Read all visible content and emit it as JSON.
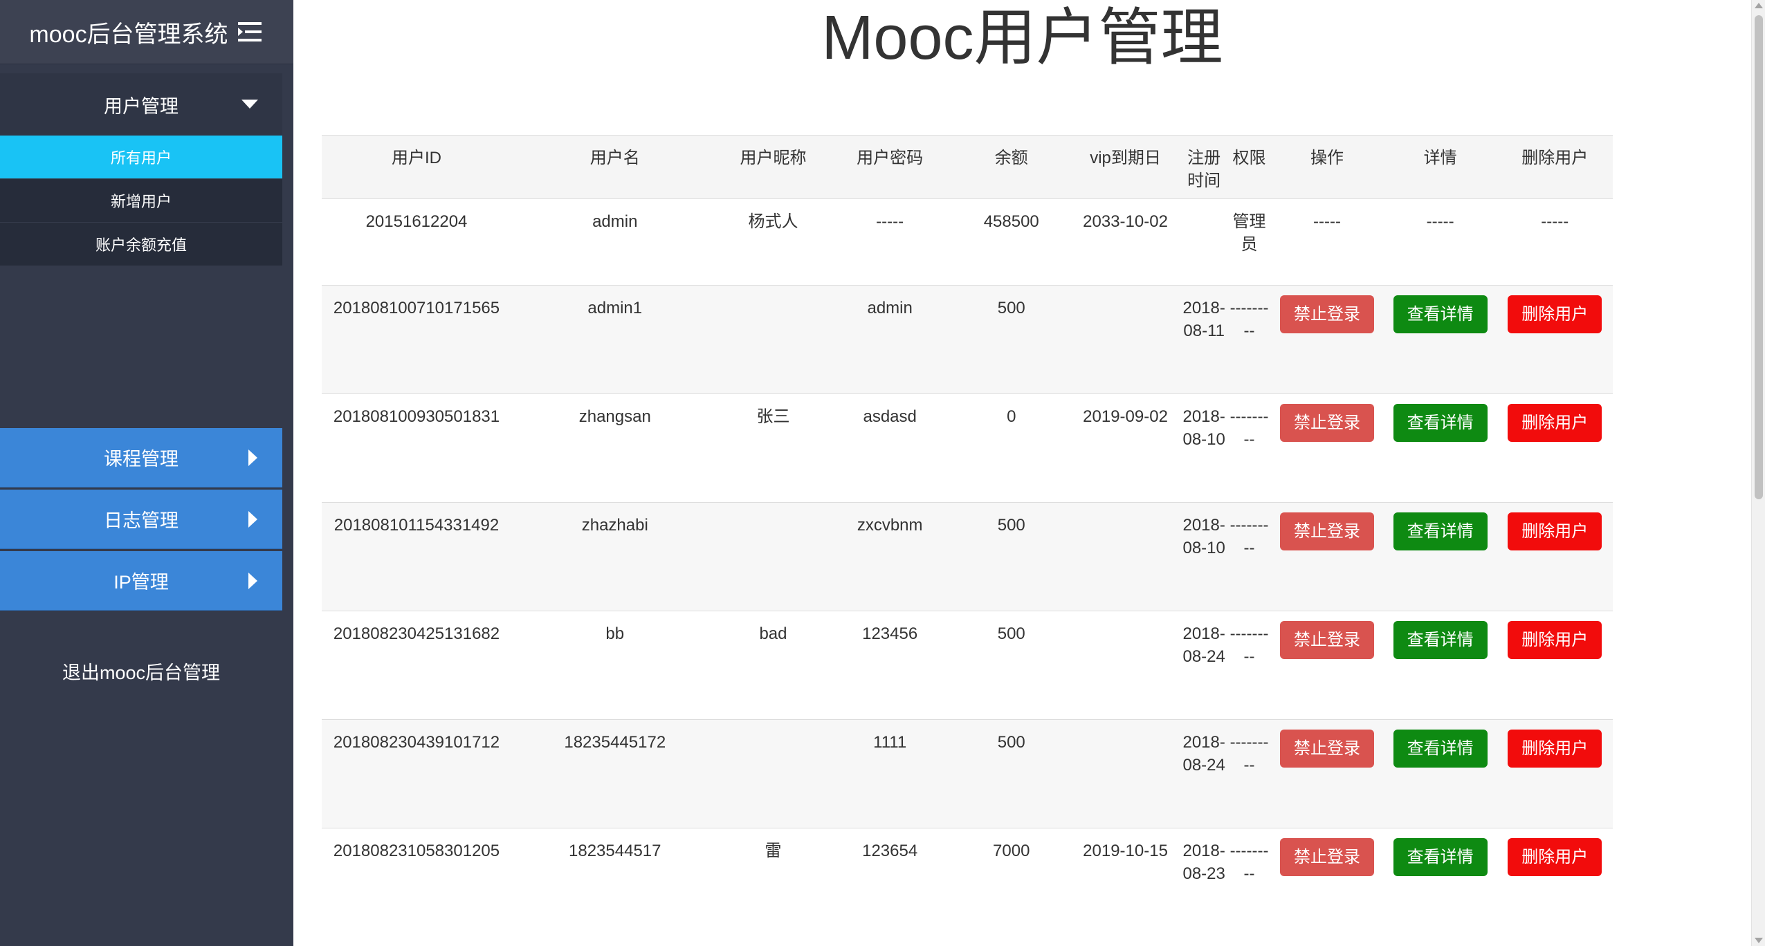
{
  "sidebar": {
    "brand": "mooc后台管理系统",
    "menu_user": "用户管理",
    "sub_items": [
      "所有用户",
      "新增用户",
      "账户余额充值"
    ],
    "menu_course": "课程管理",
    "menu_log": "日志管理",
    "menu_ip": "IP管理",
    "logout": "退出mooc后台管理"
  },
  "main": {
    "title": "Mooc用户管理"
  },
  "table": {
    "headers": {
      "id": "用户ID",
      "name": "用户名",
      "nickname": "用户昵称",
      "password": "用户密码",
      "balance": "余额",
      "vip": "vip到期日",
      "reg": "注册时间",
      "role": "权限",
      "op": "操作",
      "detail": "详情",
      "delete": "删除用户"
    },
    "admin_row": {
      "id": "20151612204",
      "name": "admin",
      "nickname": "杨式人",
      "password": "-----",
      "balance": "458500",
      "vip": "2033-10-02",
      "reg": "",
      "role": "管理员",
      "op": "-----",
      "detail": "-----",
      "delete": "-----"
    },
    "rows": [
      {
        "id": "201808100710171565",
        "name": "admin1",
        "nickname": "",
        "password": "admin",
        "balance": "500",
        "vip": "",
        "reg": "2018-08-11",
        "role": "---------"
      },
      {
        "id": "201808100930501831",
        "name": "zhangsan",
        "nickname": "张三",
        "password": "asdasd",
        "balance": "0",
        "vip": "2019-09-02",
        "reg": "2018-08-10",
        "role": "---------"
      },
      {
        "id": "201808101154331492",
        "name": "zhazhabi",
        "nickname": "",
        "password": "zxcvbnm",
        "balance": "500",
        "vip": "",
        "reg": "2018-08-10",
        "role": "---------"
      },
      {
        "id": "201808230425131682",
        "name": "bb",
        "nickname": "bad",
        "password": "123456",
        "balance": "500",
        "vip": "",
        "reg": "2018-08-24",
        "role": "---------"
      },
      {
        "id": "201808230439101712",
        "name": "18235445172",
        "nickname": "",
        "password": "1111",
        "balance": "500",
        "vip": "",
        "reg": "2018-08-24",
        "role": "---------"
      },
      {
        "id": "201808231058301205",
        "name": "1823544517",
        "nickname": "雷",
        "password": "123654",
        "balance": "7000",
        "vip": "2019-10-15",
        "reg": "2018-08-23",
        "role": "---------"
      }
    ],
    "btn_ban": "禁止登录",
    "btn_detail": "查看详情",
    "btn_delete": "删除用户"
  },
  "colors": {
    "sidebar_bg": "#343a4b",
    "active_item": "#19c3f5",
    "menu_blue": "#3b86d8",
    "ban_button": "#d9534f",
    "detail_button": "#0e8a12",
    "delete_button": "#f20c0c"
  },
  "icons": {
    "brand_toggle": "menu-toggle-icon",
    "expanded": "caret-down-icon",
    "collapsed": "caret-right-icon"
  }
}
